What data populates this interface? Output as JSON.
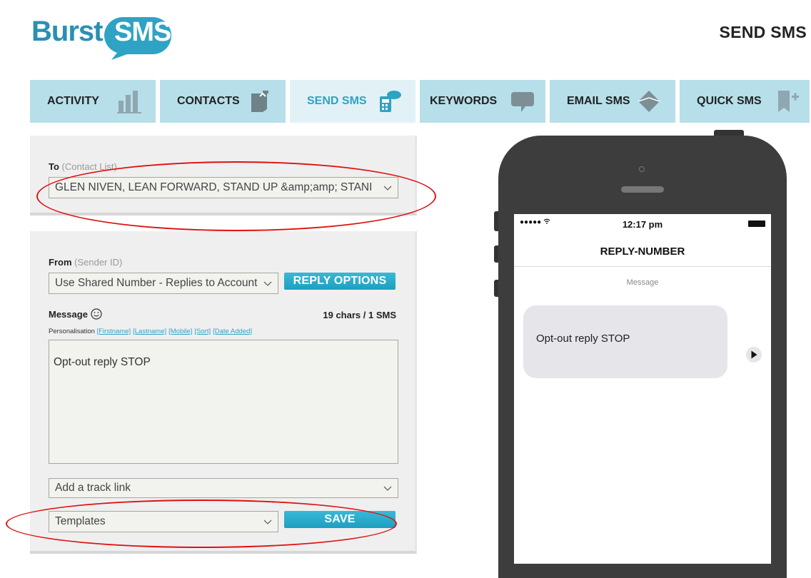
{
  "logo": {
    "burst": "Burst",
    "sms": "SMS"
  },
  "page_title": "SEND SMS",
  "nav": {
    "tabs": [
      {
        "label": "ACTIVITY",
        "icon": "bar-chart-icon",
        "active": false
      },
      {
        "label": "CONTACTS",
        "icon": "contacts-book-icon",
        "active": false
      },
      {
        "label": "SEND SMS",
        "icon": "send-sms-phone-icon",
        "active": true
      },
      {
        "label": "KEYWORDS",
        "icon": "speech-bubble-icon",
        "active": false
      },
      {
        "label": "EMAIL SMS",
        "icon": "envelope-icon",
        "active": false
      },
      {
        "label": "QUICK SMS",
        "icon": "quick-add-icon",
        "active": false
      }
    ]
  },
  "to": {
    "label": "To",
    "sublabel": "(Contact List)",
    "value": "GLEN NIVEN, LEAN FORWARD, STAND UP &amp;amp; STANI"
  },
  "from": {
    "label": "From",
    "sublabel": "(Sender ID)",
    "value": "Use Shared Number - Replies to Account",
    "reply_options_label": "REPLY OPTIONS"
  },
  "message": {
    "label": "Message",
    "char_count": "19 chars / 1 SMS",
    "personalisation_label": "Personalisation",
    "personalisation_links": [
      "[Firstname]",
      "[Lastname]",
      "[Mobile]",
      "[Sort]",
      "[Date Added]"
    ],
    "text": "Opt-out reply STOP"
  },
  "track_link": {
    "placeholder": "Add a track link"
  },
  "templates": {
    "value": "Templates"
  },
  "save_label": "SAVE",
  "phone_preview": {
    "signal": "●●●●● ",
    "time": "12:17 pm",
    "contact": "REPLY-NUMBER",
    "message_header": "Message",
    "bubble_text": "Opt-out reply STOP"
  },
  "colors": {
    "tab_bg": "#b6dfea",
    "tab_active_bg": "#e2f1f6",
    "accent": "#2ea3c4",
    "annotation_red": "#e01010",
    "phone_body": "#3d3d3d"
  }
}
